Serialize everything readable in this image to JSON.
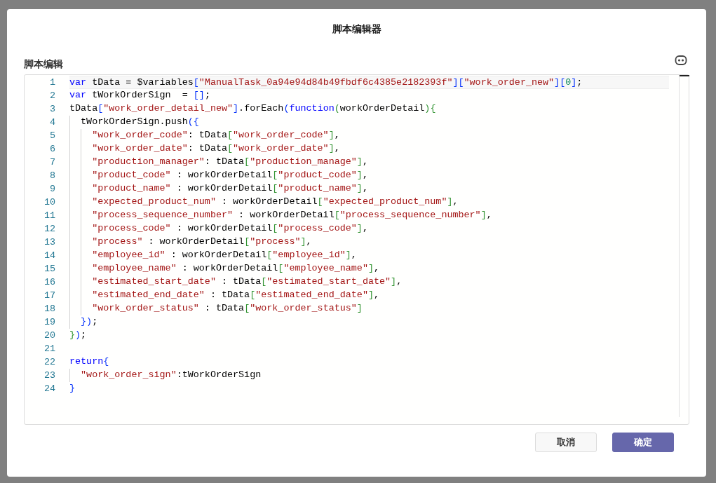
{
  "dialog": {
    "title": "脚本编辑器",
    "section_label": "脚本编辑",
    "editor": {
      "lines": [
        {
          "number": "1",
          "tokens": [
            {
              "kind": "keyword",
              "text": "var"
            },
            {
              "kind": "plain",
              "text": " tData = $variables"
            },
            {
              "kind": "bracket1",
              "text": "["
            },
            {
              "kind": "string",
              "text": "\"ManualTask_0a94e94d84b49fbdf6c4385e2182393f\""
            },
            {
              "kind": "bracket1",
              "text": "]["
            },
            {
              "kind": "string",
              "text": "\"work_order_new\""
            },
            {
              "kind": "bracket1",
              "text": "]["
            },
            {
              "kind": "number",
              "text": "0"
            },
            {
              "kind": "bracket1",
              "text": "]"
            },
            {
              "kind": "plain",
              "text": ";"
            }
          ]
        },
        {
          "number": "2",
          "tokens": [
            {
              "kind": "keyword",
              "text": "var"
            },
            {
              "kind": "plain",
              "text": " tWorkOrderSign  = "
            },
            {
              "kind": "bracket1",
              "text": "[]"
            },
            {
              "kind": "plain",
              "text": ";"
            }
          ]
        },
        {
          "number": "3",
          "tokens": [
            {
              "kind": "plain",
              "text": "tData"
            },
            {
              "kind": "bracket1",
              "text": "["
            },
            {
              "kind": "string",
              "text": "\"work_order_detail_new\""
            },
            {
              "kind": "bracket1",
              "text": "]"
            },
            {
              "kind": "plain",
              "text": ".forEach"
            },
            {
              "kind": "bracket1",
              "text": "("
            },
            {
              "kind": "keyword",
              "text": "function"
            },
            {
              "kind": "bracket2",
              "text": "("
            },
            {
              "kind": "plain",
              "text": "workOrderDetail"
            },
            {
              "kind": "bracket2",
              "text": "){"
            }
          ]
        },
        {
          "number": "4",
          "tokens": [
            {
              "kind": "plain",
              "text": "  tWorkOrderSign.push"
            },
            {
              "kind": "bracket1",
              "text": "({"
            }
          ]
        },
        {
          "number": "5",
          "tokens": [
            {
              "kind": "string",
              "text": "    \"work_order_code\""
            },
            {
              "kind": "plain",
              "text": ": tData"
            },
            {
              "kind": "bracket2",
              "text": "["
            },
            {
              "kind": "string",
              "text": "\"work_order_code\""
            },
            {
              "kind": "bracket2",
              "text": "]"
            },
            {
              "kind": "plain",
              "text": ","
            }
          ]
        },
        {
          "number": "6",
          "tokens": [
            {
              "kind": "string",
              "text": "    \"work_order_date\""
            },
            {
              "kind": "plain",
              "text": ": tData"
            },
            {
              "kind": "bracket2",
              "text": "["
            },
            {
              "kind": "string",
              "text": "\"work_order_date\""
            },
            {
              "kind": "bracket2",
              "text": "]"
            },
            {
              "kind": "plain",
              "text": ","
            }
          ]
        },
        {
          "number": "7",
          "tokens": [
            {
              "kind": "string",
              "text": "    \"production_manager\""
            },
            {
              "kind": "plain",
              "text": ": tData"
            },
            {
              "kind": "bracket2",
              "text": "["
            },
            {
              "kind": "string",
              "text": "\"production_manage\""
            },
            {
              "kind": "bracket2",
              "text": "]"
            },
            {
              "kind": "plain",
              "text": ","
            }
          ]
        },
        {
          "number": "8",
          "tokens": [
            {
              "kind": "string",
              "text": "    \"product_code\""
            },
            {
              "kind": "plain",
              "text": " : workOrderDetail"
            },
            {
              "kind": "bracket2",
              "text": "["
            },
            {
              "kind": "string",
              "text": "\"product_code\""
            },
            {
              "kind": "bracket2",
              "text": "]"
            },
            {
              "kind": "plain",
              "text": ","
            }
          ]
        },
        {
          "number": "9",
          "tokens": [
            {
              "kind": "string",
              "text": "    \"product_name\""
            },
            {
              "kind": "plain",
              "text": " : workOrderDetail"
            },
            {
              "kind": "bracket2",
              "text": "["
            },
            {
              "kind": "string",
              "text": "\"product_name\""
            },
            {
              "kind": "bracket2",
              "text": "]"
            },
            {
              "kind": "plain",
              "text": ","
            }
          ]
        },
        {
          "number": "10",
          "tokens": [
            {
              "kind": "string",
              "text": "    \"expected_product_num\""
            },
            {
              "kind": "plain",
              "text": " : workOrderDetail"
            },
            {
              "kind": "bracket2",
              "text": "["
            },
            {
              "kind": "string",
              "text": "\"expected_product_num\""
            },
            {
              "kind": "bracket2",
              "text": "]"
            },
            {
              "kind": "plain",
              "text": ","
            }
          ]
        },
        {
          "number": "11",
          "tokens": [
            {
              "kind": "string",
              "text": "    \"process_sequence_number\""
            },
            {
              "kind": "plain",
              "text": " : workOrderDetail"
            },
            {
              "kind": "bracket2",
              "text": "["
            },
            {
              "kind": "string",
              "text": "\"process_sequence_number\""
            },
            {
              "kind": "bracket2",
              "text": "]"
            },
            {
              "kind": "plain",
              "text": ","
            }
          ]
        },
        {
          "number": "12",
          "tokens": [
            {
              "kind": "string",
              "text": "    \"process_code\""
            },
            {
              "kind": "plain",
              "text": " : workOrderDetail"
            },
            {
              "kind": "bracket2",
              "text": "["
            },
            {
              "kind": "string",
              "text": "\"process_code\""
            },
            {
              "kind": "bracket2",
              "text": "]"
            },
            {
              "kind": "plain",
              "text": ","
            }
          ]
        },
        {
          "number": "13",
          "tokens": [
            {
              "kind": "string",
              "text": "    \"process\""
            },
            {
              "kind": "plain",
              "text": " : workOrderDetail"
            },
            {
              "kind": "bracket2",
              "text": "["
            },
            {
              "kind": "string",
              "text": "\"process\""
            },
            {
              "kind": "bracket2",
              "text": "]"
            },
            {
              "kind": "plain",
              "text": ","
            }
          ]
        },
        {
          "number": "14",
          "tokens": [
            {
              "kind": "string",
              "text": "    \"employee_id\""
            },
            {
              "kind": "plain",
              "text": " : workOrderDetail"
            },
            {
              "kind": "bracket2",
              "text": "["
            },
            {
              "kind": "string",
              "text": "\"employee_id\""
            },
            {
              "kind": "bracket2",
              "text": "]"
            },
            {
              "kind": "plain",
              "text": ","
            }
          ]
        },
        {
          "number": "15",
          "tokens": [
            {
              "kind": "string",
              "text": "    \"employee_name\""
            },
            {
              "kind": "plain",
              "text": " : workOrderDetail"
            },
            {
              "kind": "bracket2",
              "text": "["
            },
            {
              "kind": "string",
              "text": "\"employee_name\""
            },
            {
              "kind": "bracket2",
              "text": "]"
            },
            {
              "kind": "plain",
              "text": ","
            }
          ]
        },
        {
          "number": "16",
          "tokens": [
            {
              "kind": "string",
              "text": "    \"estimated_start_date\""
            },
            {
              "kind": "plain",
              "text": " : tData"
            },
            {
              "kind": "bracket2",
              "text": "["
            },
            {
              "kind": "string",
              "text": "\"estimated_start_date\""
            },
            {
              "kind": "bracket2",
              "text": "]"
            },
            {
              "kind": "plain",
              "text": ","
            }
          ]
        },
        {
          "number": "17",
          "tokens": [
            {
              "kind": "string",
              "text": "    \"estimated_end_date\""
            },
            {
              "kind": "plain",
              "text": " : tData"
            },
            {
              "kind": "bracket2",
              "text": "["
            },
            {
              "kind": "string",
              "text": "\"estimated_end_date\""
            },
            {
              "kind": "bracket2",
              "text": "]"
            },
            {
              "kind": "plain",
              "text": ","
            }
          ]
        },
        {
          "number": "18",
          "tokens": [
            {
              "kind": "string",
              "text": "    \"work_order_status\""
            },
            {
              "kind": "plain",
              "text": " : tData"
            },
            {
              "kind": "bracket2",
              "text": "["
            },
            {
              "kind": "string",
              "text": "\"work_order_status\""
            },
            {
              "kind": "bracket2",
              "text": "]"
            }
          ]
        },
        {
          "number": "19",
          "tokens": [
            {
              "kind": "bracket1",
              "text": "  })"
            },
            {
              "kind": "plain",
              "text": ";"
            }
          ]
        },
        {
          "number": "20",
          "tokens": [
            {
              "kind": "bracket2",
              "text": "}"
            },
            {
              "kind": "bracket1",
              "text": ")"
            },
            {
              "kind": "plain",
              "text": ";"
            }
          ]
        },
        {
          "number": "21"
        },
        {
          "number": "22",
          "tokens": [
            {
              "kind": "keyword",
              "text": "return"
            },
            {
              "kind": "bracket1",
              "text": "{"
            }
          ]
        },
        {
          "number": "23",
          "tokens": [
            {
              "kind": "string",
              "text": "  \"work_order_sign\""
            },
            {
              "kind": "plain",
              "text": ":tWorkOrderSign"
            }
          ]
        },
        {
          "number": "24",
          "tokens": [
            {
              "kind": "bracket1",
              "text": "}"
            }
          ]
        }
      ]
    },
    "buttons": [
      {
        "kind": "secondary",
        "label": "取消"
      },
      {
        "kind": "primary",
        "label": "确定"
      }
    ]
  }
}
